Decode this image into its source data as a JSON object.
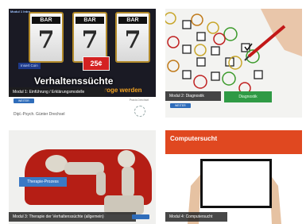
{
  "cards": [
    {
      "module_label": "Modul 1: Einführung / Erklärungsmodelle",
      "cta": "WEITER",
      "hero_title": "Verhaltenssüchte",
      "hero_subtitle": "roge werden",
      "slot_labels": [
        "BAR",
        "BAR",
        "BAR"
      ],
      "slot_symbols": [
        "7",
        "7",
        "7"
      ],
      "payout_label": "25¢",
      "top_tag": "Modul 1 Intro",
      "side_tag": "Insert Coin",
      "author": "Dipl.-Psych. Günter Drechsel",
      "logo_text": "Praxis Drechsel"
    },
    {
      "module_label": "Modul 2: Diagnostik",
      "cta": "WEITER",
      "green_label": "Diagnostik"
    },
    {
      "module_label": "Modul 3: Therapie der Verhaltenssüchte (allgemein)",
      "therapy_button": "Therapie-Prozess"
    },
    {
      "module_label": "Modul 4: Computersucht",
      "header_title": "Computersucht"
    }
  ],
  "colors": {
    "module_bar": "#1e1e1e",
    "cta_blue": "#2f6dba",
    "orange_header": "#e04820",
    "diagnostik_green": "#2f9a45",
    "sofa_red": "#b51e15"
  }
}
